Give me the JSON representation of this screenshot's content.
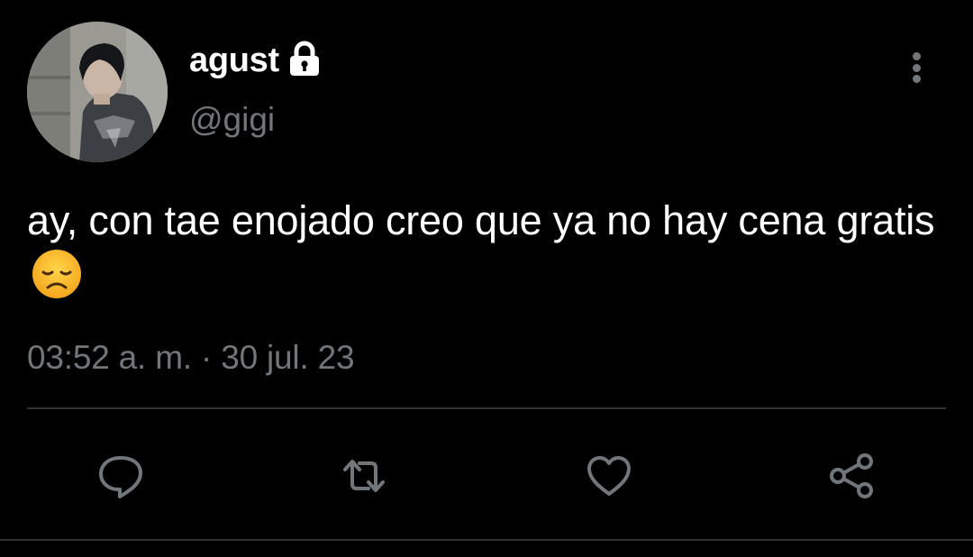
{
  "user": {
    "display_name": "agust",
    "handle": "@gigi",
    "protected_icon": "lock-icon",
    "avatar": "profile-photo"
  },
  "tweet": {
    "text": "ay, con tae enojado creo que ya no hay cena gratis",
    "emoji": "disappointed-face",
    "timestamp": "03:52 a. m. · 30 jul. 23"
  },
  "actions": {
    "reply": "reply-icon",
    "retweet": "retweet-icon",
    "like": "heart-icon",
    "share": "share-icon",
    "more": "more-vertical-icon"
  },
  "colors": {
    "background": "#000000",
    "text": "#ffffff",
    "muted": "#71767b",
    "divider": "#2f3336"
  }
}
